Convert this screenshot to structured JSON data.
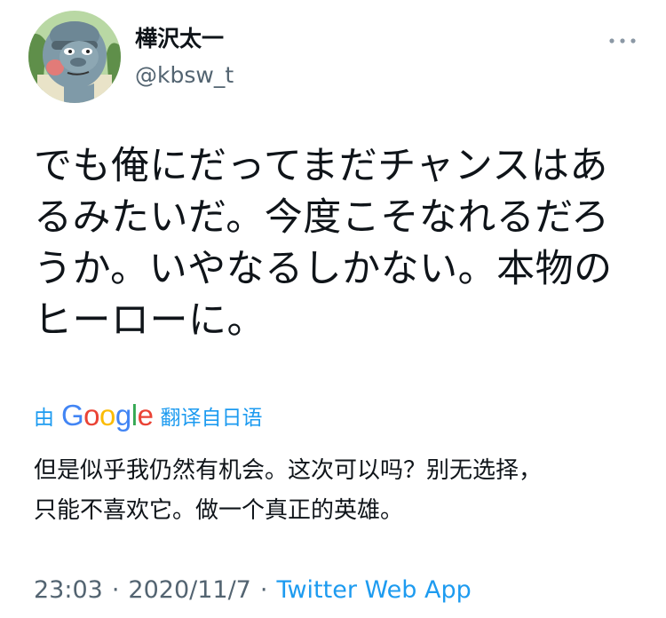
{
  "user": {
    "display_name": "樺沢太一",
    "handle": "@kbsw_t",
    "avatar_icon": "cartoon-gorilla-avatar"
  },
  "more_icon": "more-horizontal-icon",
  "tweet": {
    "lines": [
      "でも俺にだってまだチャンスはあ",
      "るみたいだ。今度こそなれるだろ",
      "うか。いやなるしかない。本物の",
      "ヒーローに。"
    ]
  },
  "translation": {
    "prefix": "由",
    "logo_text": "Google",
    "suffix": "翻译自日语",
    "lines": [
      "但是似乎我仍然有机会。这次可以吗？别无选择，",
      "只能不喜欢它。做一个真正的英雄。"
    ],
    "logo_colors": [
      "#4285F4",
      "#EA4335",
      "#FBBC05",
      "#4285F4",
      "#34A853",
      "#EA4335"
    ]
  },
  "meta": {
    "time": "23:03",
    "separator": "·",
    "date": "2020/11/7",
    "source": "Twitter Web App"
  },
  "colors": {
    "accent": "#1d9bf0",
    "secondary_text": "#536471",
    "primary_text": "#0f1419"
  }
}
